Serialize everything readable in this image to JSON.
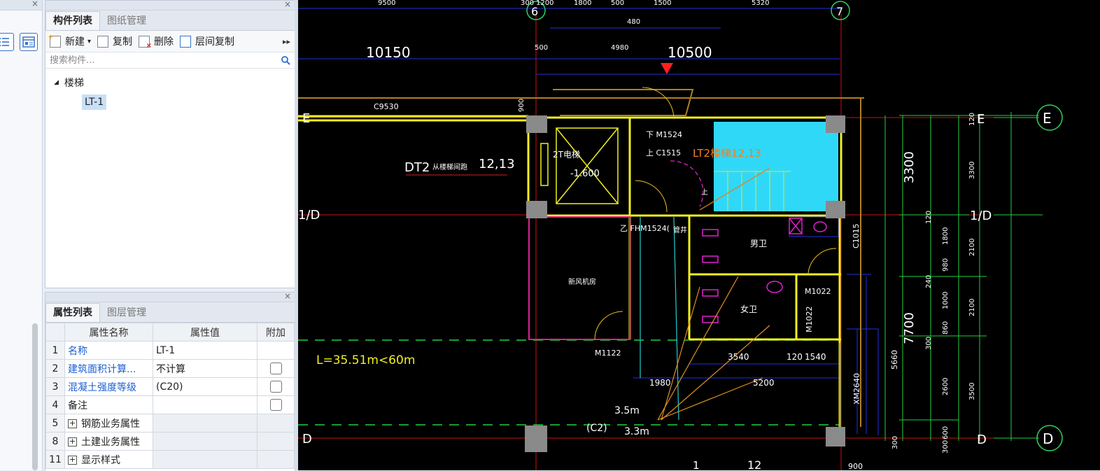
{
  "left_strip": {
    "close_label": "×"
  },
  "component_panel": {
    "close_label": "×",
    "tabs": [
      {
        "label": "构件列表",
        "active": true
      },
      {
        "label": "图纸管理",
        "active": false
      }
    ],
    "toolbar": {
      "new_label": "新建",
      "new_caret": "▾",
      "copy_label": "复制",
      "delete_label": "删除",
      "floor_copy_label": "层间复制",
      "more_label": "▸▸"
    },
    "search": {
      "placeholder": "搜索构件..."
    },
    "tree": {
      "group_label": "楼梯",
      "group_caret": "◢",
      "items": [
        "LT-1"
      ]
    }
  },
  "property_panel": {
    "close_label": "×",
    "tabs": [
      {
        "label": "属性列表",
        "active": true
      },
      {
        "label": "图层管理",
        "active": false
      }
    ],
    "headers": [
      "属性名称",
      "属性值",
      "附加"
    ],
    "rows": [
      {
        "num": "1",
        "name": "名称",
        "value": "LT-1",
        "blue": true,
        "checkbox": false
      },
      {
        "num": "2",
        "name": "建筑面积计算...",
        "value": "不计算",
        "blue": true,
        "checkbox": true
      },
      {
        "num": "3",
        "name": "混凝土强度等级",
        "value": "(C20)",
        "blue": true,
        "checkbox": true
      },
      {
        "num": "4",
        "name": "备注",
        "value": "",
        "blue": false,
        "checkbox": true
      },
      {
        "num": "5",
        "name": "钢筋业务属性",
        "value": "",
        "blue": false,
        "expand": true
      },
      {
        "num": "8",
        "name": "土建业务属性",
        "value": "",
        "blue": false,
        "expand": true
      },
      {
        "num": "11",
        "name": "显示样式",
        "value": "",
        "blue": false,
        "expand": true
      }
    ],
    "expand_symbol": "+"
  },
  "cad": {
    "dims_top": [
      "9500",
      "300",
      "1200",
      "1800",
      "500",
      "1500",
      "5320",
      "480",
      "500",
      "4980"
    ],
    "axis_6": "6",
    "axis_7": "7",
    "dim_10150": "10150",
    "dim_10500": "10500",
    "axis_E": "E",
    "axis_1D": "1/D",
    "axis_D": "D",
    "c9530": "C9530",
    "v900": "900",
    "dt2": "DT2",
    "dt2_note": "从楼梯间跑",
    "dt2_num": "12,13",
    "elevator": "2T电梯",
    "elev_level": "-1.600",
    "door_m1524": "下 M1524",
    "window_c1515": "上 C1515",
    "lt2": "LT2楼梯12,13",
    "up_mark": "上",
    "fm1524": "乙 FHM1524(",
    "shaft_label": "管井",
    "room_label": "新风机房",
    "male_wc": "男卫",
    "female_wc": "女卫",
    "c1015": "C1015",
    "m1022a": "M1022",
    "m1022b": "M1022",
    "m1122": "M1122",
    "fire_dist": "L=35.51m<60m",
    "d3540": "3540",
    "d120": "120",
    "d1540": "1540",
    "d1980": "1980",
    "d5200": "5200",
    "net_height": "3.5m",
    "c2": "(C2)",
    "height_33": "3.3m",
    "km2640": "XM2640",
    "d5660": "5660",
    "d3300": "3300",
    "d7700": "7700",
    "right_120a": "120",
    "right_3300": "3300",
    "right_120b": "120",
    "right_1800": "1800",
    "right_2100a": "2100",
    "right_980": "980",
    "right_240": "240",
    "right_1000": "1000",
    "right_2100b": "2100",
    "right_860": "860",
    "right_300a": "300",
    "right_2600": "2600",
    "right_3500": "3500",
    "right_600": "600",
    "right_300b": "300",
    "right_300c": "300",
    "bottom_1": "1",
    "bottom_12": "12",
    "bottom_900": "900"
  }
}
